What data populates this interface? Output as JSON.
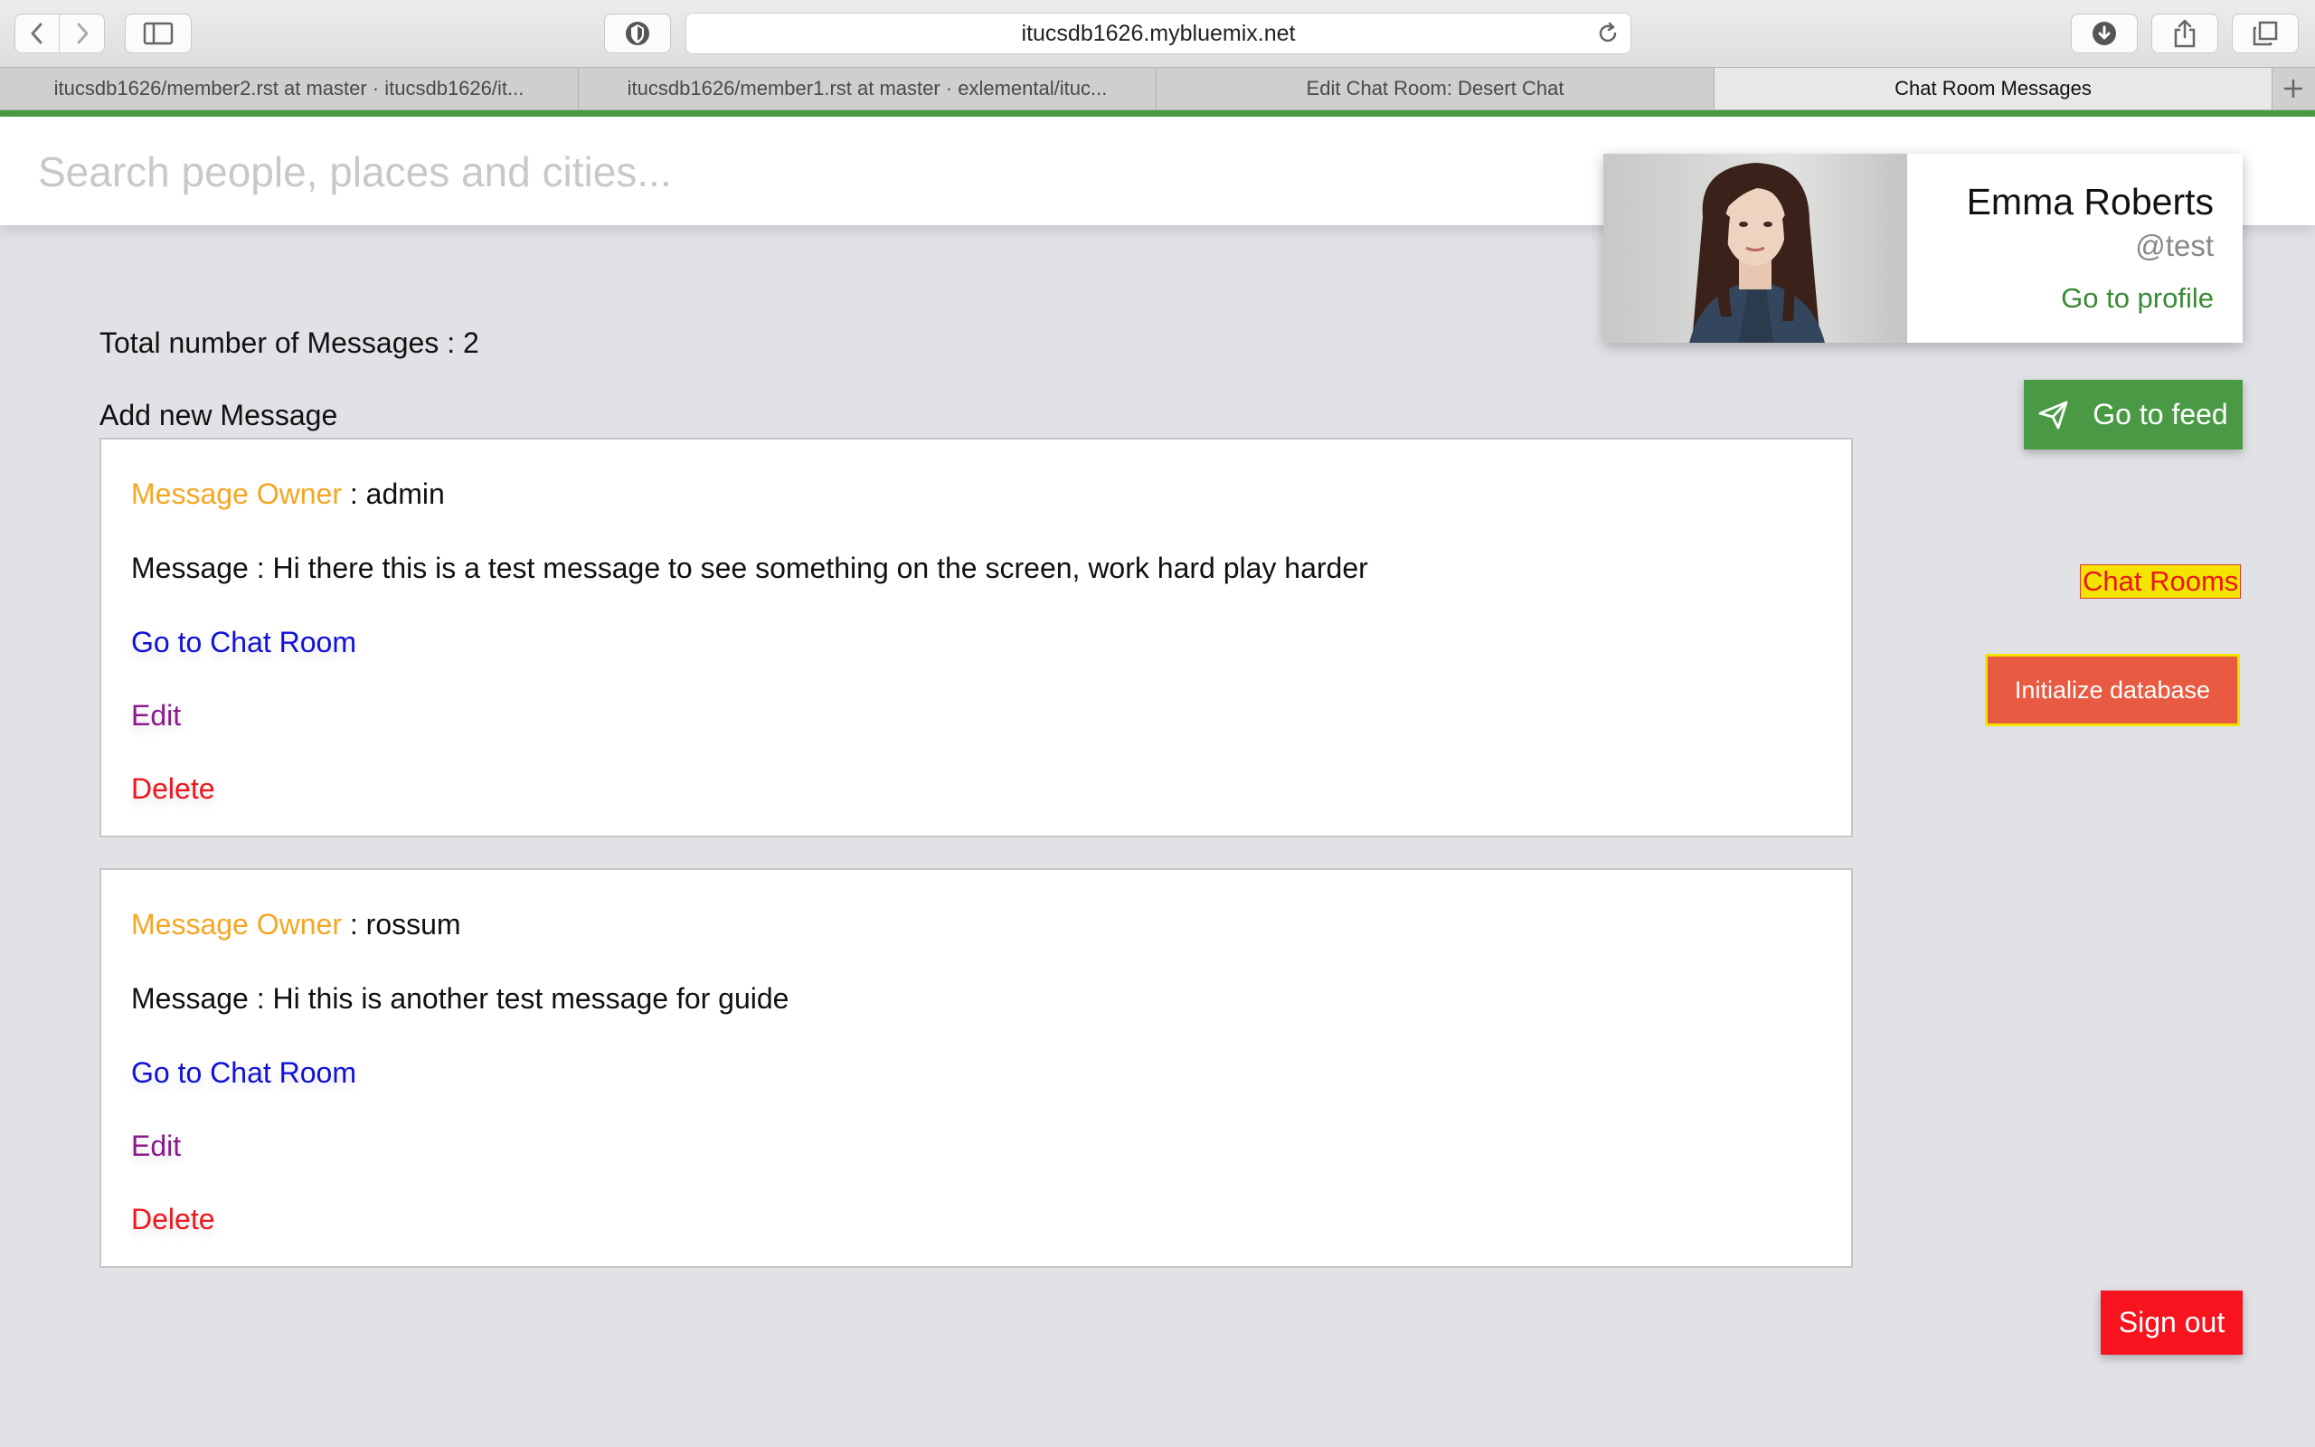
{
  "browser": {
    "url": "itucsdb1626.mybluemix.net",
    "tabs": [
      {
        "label": "itucsdb1626/member2.rst at master · itucsdb1626/it..."
      },
      {
        "label": "itucsdb1626/member1.rst at master · exlemental/ituc..."
      },
      {
        "label": "Edit Chat Room: Desert Chat"
      },
      {
        "label": "Chat Room Messages"
      }
    ],
    "active_tab": 3,
    "icons": [
      "back-icon",
      "forward-icon",
      "sidebar-icon",
      "privacy-icon",
      "reload-icon",
      "download-icon",
      "share-icon",
      "tabs-overview-icon",
      "new-tab-icon"
    ]
  },
  "search": {
    "placeholder": "Search people, places and cities..."
  },
  "profile": {
    "name": "Emma Roberts",
    "handle": "@test",
    "link_label": "Go to profile"
  },
  "sidebar": {
    "feed_label": "Go to feed",
    "chat_rooms_label": "Chat Rooms",
    "init_db_label": "Initialize database",
    "sign_out_label": "Sign out"
  },
  "main": {
    "total_messages": "Total number of Messages : 2",
    "add_new": "Add new Message",
    "owner_label": "Message Owner",
    "goto_label": "Go to Chat Room",
    "edit_label": "Edit",
    "delete_label": "Delete",
    "messages": [
      {
        "owner": ": admin",
        "message": "Message : Hi there this is a test message to see something on the screen, work hard play harder"
      },
      {
        "owner": ": rossum",
        "message": "Message : Hi this is another test message for guide"
      }
    ]
  },
  "colors": {
    "accent_green": "#4a9a45",
    "owner_orange": "#f5a623",
    "link_blue": "#1010d8",
    "edit_purple": "#8b1a8a",
    "delete_red": "#f0141c",
    "init_db_red": "#e85a41",
    "chat_rooms_yellow": "#f5e400"
  }
}
